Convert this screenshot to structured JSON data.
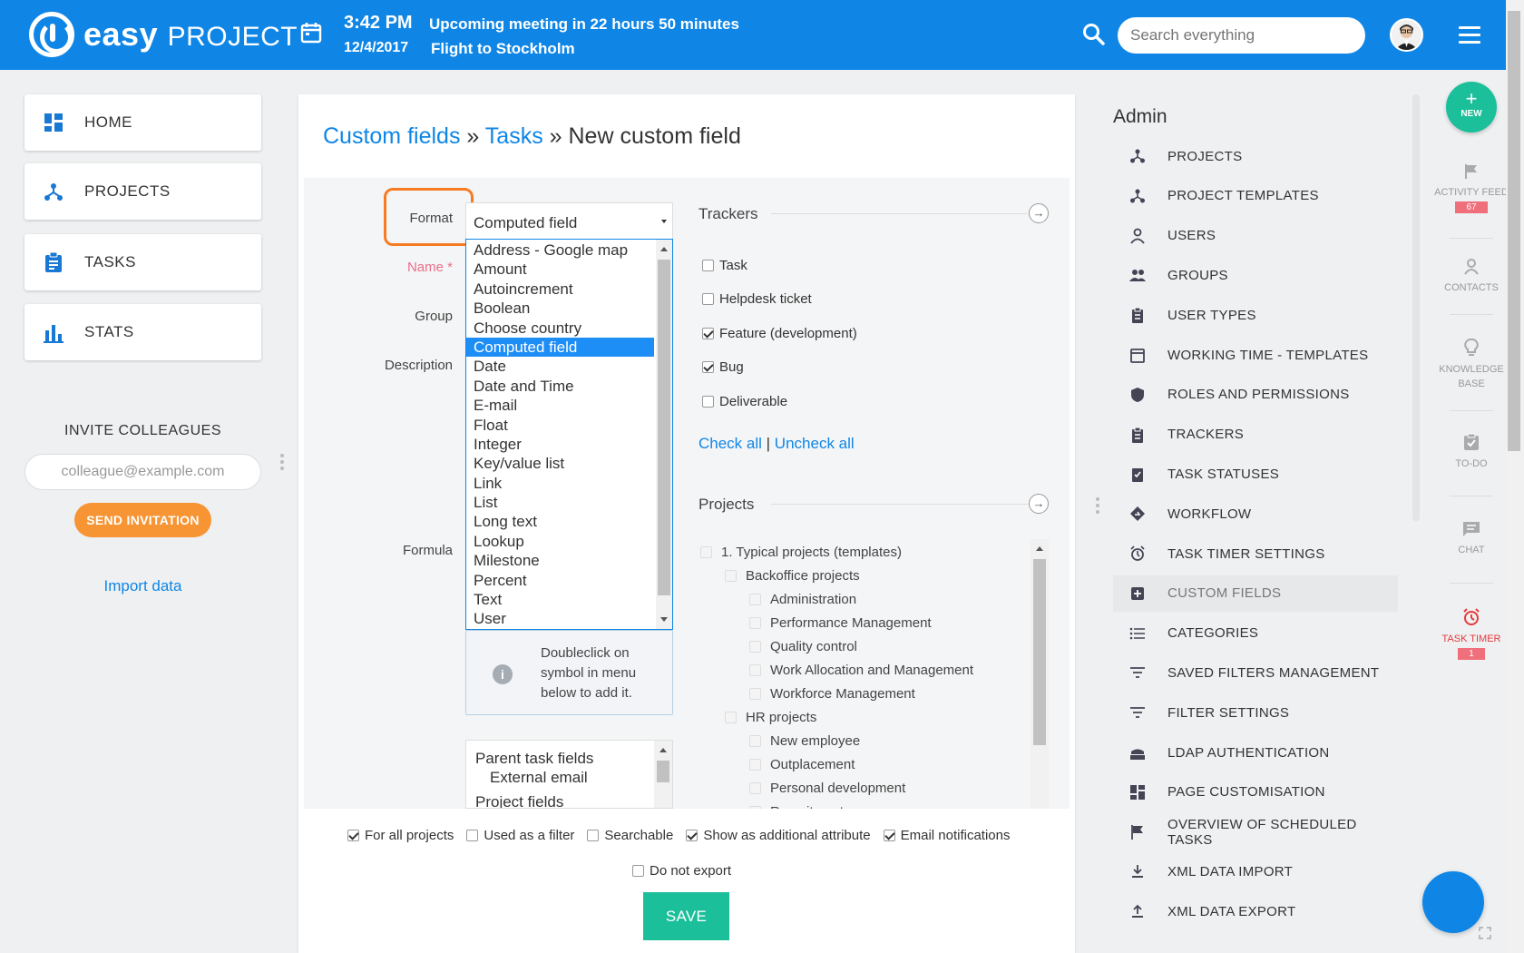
{
  "header": {
    "logo_main": "easy",
    "logo_sub": "PROJECT",
    "time": "3:42 PM",
    "date": "12/4/2017",
    "event1": "Upcoming meeting in 22 hours 50 minutes",
    "event2": "Flight to Stockholm",
    "search_placeholder": "Search everything"
  },
  "left_nav": {
    "items": [
      {
        "label": "HOME",
        "icon": "dashboard-icon"
      },
      {
        "label": "PROJECTS",
        "icon": "projects-icon"
      },
      {
        "label": "TASKS",
        "icon": "clipboard-icon"
      },
      {
        "label": "STATS",
        "icon": "bar-chart-icon"
      }
    ],
    "invite_title": "INVITE COLLEAGUES",
    "invite_placeholder": "colleague@example.com",
    "send_label": "SEND INVITATION",
    "import_label": "Import data"
  },
  "breadcrumb": {
    "part1": "Custom fields",
    "sep": " » ",
    "part2": "Tasks",
    "part3": "New custom field"
  },
  "form": {
    "labels": {
      "format": "Format",
      "name": "Name *",
      "group": "Group",
      "description": "Description",
      "formula": "Formula"
    },
    "format_value": "Computed field",
    "format_options": [
      "Address - Google map",
      "Amount",
      "Autoincrement",
      "Boolean",
      "Choose country",
      "Computed field",
      "Date",
      "Date and Time",
      "E-mail",
      "Float",
      "Integer",
      "Key/value list",
      "Link",
      "List",
      "Long text",
      "Lookup",
      "Milestone",
      "Percent",
      "Text",
      "User"
    ],
    "selected_option": "Computed field",
    "info_text": "Doubleclick on symbol in menu below to add it.",
    "symbols": {
      "s1": "Parent task fields",
      "s2": "External email",
      "s3": "Project fields"
    }
  },
  "trackers": {
    "title": "Trackers",
    "items": [
      {
        "label": "Task",
        "checked": false
      },
      {
        "label": "Helpdesk ticket",
        "checked": false
      },
      {
        "label": "Feature (development)",
        "checked": true
      },
      {
        "label": "Bug",
        "checked": true
      },
      {
        "label": "Deliverable",
        "checked": false
      }
    ],
    "check_all": "Check all",
    "sep": " | ",
    "uncheck_all": "Uncheck all"
  },
  "projects": {
    "title": "Projects",
    "items": [
      {
        "label": "1. Typical projects (templates)",
        "level": 0
      },
      {
        "label": "Backoffice projects",
        "level": 1
      },
      {
        "label": "Administration",
        "level": 2
      },
      {
        "label": "Performance Management",
        "level": 2
      },
      {
        "label": "Quality control",
        "level": 2
      },
      {
        "label": "Work Allocation and Management",
        "level": 2
      },
      {
        "label": "Workforce Management",
        "level": 2
      },
      {
        "label": "HR projects",
        "level": 1
      },
      {
        "label": "New employee",
        "level": 2
      },
      {
        "label": "Outplacement",
        "level": 2
      },
      {
        "label": "Personal development",
        "level": 2
      },
      {
        "label": "Recruitment",
        "level": 2
      }
    ]
  },
  "bottom_options": [
    {
      "label": "For all projects",
      "checked": true
    },
    {
      "label": "Used as a filter",
      "checked": false
    },
    {
      "label": "Searchable",
      "checked": false
    },
    {
      "label": "Show as additional attribute",
      "checked": true
    },
    {
      "label": "Email notifications",
      "checked": true
    }
  ],
  "do_not_export": {
    "label": "Do not export",
    "checked": false
  },
  "save_label": "SAVE",
  "admin": {
    "title": "Admin",
    "items": [
      "PROJECTS",
      "PROJECT TEMPLATES",
      "USERS",
      "GROUPS",
      "USER TYPES",
      "WORKING TIME - TEMPLATES",
      "ROLES AND PERMISSIONS",
      "TRACKERS",
      "TASK STATUSES",
      "WORKFLOW",
      "TASK TIMER SETTINGS",
      "CUSTOM FIELDS",
      "CATEGORIES",
      "SAVED FILTERS MANAGEMENT",
      "FILTER SETTINGS",
      "LDAP AUTHENTICATION",
      "PAGE CUSTOMISATION",
      "OVERVIEW OF SCHEDULED TASKS",
      "XML DATA IMPORT",
      "XML DATA EXPORT"
    ],
    "active": "CUSTOM FIELDS"
  },
  "rail": {
    "new_label": "NEW",
    "activity_label": "ACTIVITY FEED",
    "activity_count": "67",
    "contacts_label": "CONTACTS",
    "kb_label": "KNOWLEDGE BASE",
    "todo_label": "TO-DO",
    "chat_label": "CHAT",
    "timer_label": "TASK TIMER",
    "timer_count": "1"
  },
  "colors": {
    "header_bg": "#0f86e6",
    "accent_orange": "#f79433",
    "save_green": "#1bbf9a",
    "highlight": "#f77b22"
  }
}
